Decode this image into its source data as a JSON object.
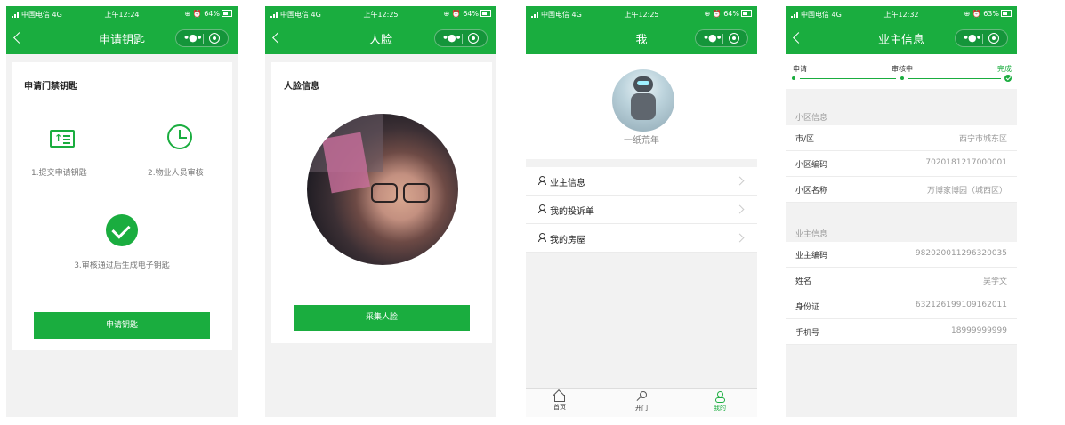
{
  "status": {
    "carrier": "中国电信 4G",
    "time1": "上午12:24",
    "time2": "上午12:25",
    "time3": "上午12:25",
    "time4": "上午12:32",
    "battery1": "⊕ ⏰ 64%",
    "battery2": "⊕ ⏰ 64%",
    "battery3": "⊕ ⏰ 64%",
    "battery4": "⊕ ⏰ 63%"
  },
  "screen1": {
    "nav_title": "申请钥匙",
    "card_title": "申请门禁钥匙",
    "step1": "1.提交申请钥匙",
    "step2": "2.物业人员审核",
    "step3": "3.审核通过后生成电子钥匙",
    "button": "申请钥匙"
  },
  "screen2": {
    "nav_title": "人脸",
    "card_title": "人脸信息",
    "button": "采集人脸"
  },
  "screen3": {
    "nav_title": "我",
    "profile_name": "一纸荒年",
    "menu": [
      {
        "label": "业主信息"
      },
      {
        "label": "我的投诉单"
      },
      {
        "label": "我的房屋"
      }
    ],
    "tabs": [
      {
        "label": "首页"
      },
      {
        "label": "开门"
      },
      {
        "label": "我的"
      }
    ]
  },
  "screen4": {
    "nav_title": "业主信息",
    "progress": [
      "申请",
      "审核中",
      "完成"
    ],
    "section1": "小区信息",
    "community": [
      {
        "key": "市/区",
        "value": "西宁市城东区"
      },
      {
        "key": "小区编码",
        "value": "7020181217000001"
      },
      {
        "key": "小区名称",
        "value": "万博家博园（城西区）"
      }
    ],
    "section2": "业主信息",
    "owner": [
      {
        "key": "业主编码",
        "value": "982020011296320035"
      },
      {
        "key": "姓名",
        "value": "吴学文"
      },
      {
        "key": "身份证",
        "value": "632126199109162011"
      },
      {
        "key": "手机号",
        "value": "18999999999"
      }
    ]
  },
  "colors": {
    "brand_green": "#1aad3f"
  },
  "icons": [
    "back-icon",
    "more-icon",
    "close-capsule-icon",
    "upload-list-icon",
    "clock-icon",
    "check-circle-icon",
    "person-icon",
    "chevron-right-icon",
    "home-icon",
    "key-icon",
    "me-icon"
  ]
}
